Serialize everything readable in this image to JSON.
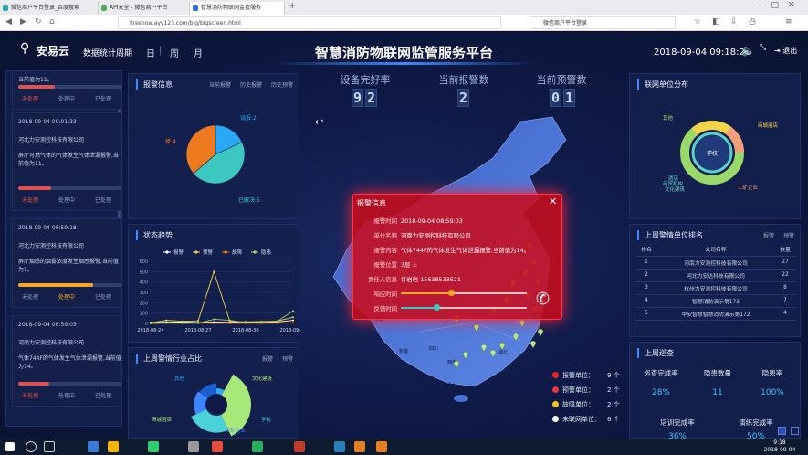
{
  "browser": {
    "tabs": [
      "微信商户平台登录_百度搜索",
      "API安全 - 微信商户平台",
      "智慧消防物联网监管服务"
    ],
    "url": "fireshow.ayy123.com/big/bigscreen.html",
    "search_value": "微信商户平台登录"
  },
  "header": {
    "logo": "安易云",
    "period_label": "数据统计周期",
    "periods": [
      "日",
      "周",
      "月"
    ],
    "title": "智慧消防物联网监管服务平台",
    "datetime": "2018-09-04 09:18:21",
    "expand_label": "缩放",
    "logout": "退出"
  },
  "kpis": [
    {
      "label": "设备完好率",
      "digits": [
        "9",
        "2"
      ]
    },
    {
      "label": "当前报警数",
      "digits": [
        "2"
      ]
    },
    {
      "label": "当前预警数",
      "digits": [
        "0",
        "1"
      ]
    }
  ],
  "feed": [
    {
      "text": "当前值为11。",
      "progress": 0.35,
      "color": "#e0524f",
      "actions": [
        "未处理",
        "处理中",
        "已处理"
      ],
      "active": 0
    },
    {
      "time": "2018-09-04 09:01:33",
      "company": "河北力安测控科技有限公司",
      "text": "屏厅可燃气体的气体发生气体泄漏报警,当前值为11。",
      "progress": 0.32,
      "color": "#e0524f",
      "actions": [
        "未处理",
        "处理中",
        "已处理"
      ],
      "active": 0
    },
    {
      "time": "2018-09-04 08:59:18",
      "company": "河北力安测控科技有限公司",
      "text": "屏厅烟感的烟雾浓度发生烟感报警,当前值为1。",
      "progress": 0.72,
      "color": "#f5a623",
      "actions": [
        "未处理",
        "处理中",
        "已处理"
      ],
      "active": 1
    },
    {
      "time": "2018-09-04 08:59:03",
      "company": "河南力安测控科技有限公司",
      "text": "气体744F的气体发生气体泄漏报警,当前值为14。",
      "progress": 0.3,
      "color": "#e0524f",
      "actions": [
        "未处理",
        "处理中",
        "已处理"
      ],
      "active": 0
    }
  ],
  "alarm_info": {
    "title": "报警信息",
    "links": [
      "当前报警",
      "历史报警",
      "历史预警"
    ],
    "pie": [
      {
        "label": "误报:2",
        "value": 2,
        "color": "#2aa7f5"
      },
      {
        "label": "已解决:5",
        "value": 5,
        "color": "#3cc8c0"
      },
      {
        "label": "已报修:4",
        "value": 4,
        "color": "#ee7a20"
      }
    ]
  },
  "trend": {
    "title": "状态趋势",
    "legend": [
      "报警",
      "预警",
      "故障",
      "隐患"
    ],
    "yticks": [
      "600",
      "500",
      "400",
      "300",
      "200",
      "100",
      "0"
    ],
    "xticks": [
      "2018-08-24",
      "2018-08-27",
      "2018-08-30",
      "2018-09-02"
    ],
    "chart_data": {
      "type": "line",
      "x": [
        "2018-08-24",
        "2018-08-25",
        "2018-08-26",
        "2018-08-27",
        "2018-08-28",
        "2018-08-29",
        "2018-08-30",
        "2018-08-31",
        "2018-09-01",
        "2018-09-02"
      ],
      "ylim": [
        0,
        600
      ],
      "series": [
        {
          "name": "报警",
          "color": "#ffffff",
          "values": [
            10,
            12,
            15,
            8,
            14,
            10,
            12,
            11,
            13,
            30
          ]
        },
        {
          "name": "预警",
          "color": "#f3d34a",
          "values": [
            5,
            30,
            20,
            25,
            500,
            20,
            15,
            18,
            22,
            60
          ]
        },
        {
          "name": "故障",
          "color": "#ee7a20",
          "values": [
            2,
            3,
            2,
            4,
            3,
            2,
            3,
            2,
            4,
            5
          ]
        },
        {
          "name": "隐患",
          "color": "#9ad86a",
          "values": [
            0,
            5,
            3,
            2,
            40,
            30,
            5,
            10,
            20,
            120
          ]
        }
      ]
    }
  },
  "industry": {
    "title": "上周警情行业占比",
    "links": [
      "报警",
      "预警"
    ],
    "labels": [
      "其他",
      "文化建筑",
      "学校",
      "工矿企业",
      "商城酒店"
    ],
    "segments": [
      {
        "label": "其他",
        "value": 8,
        "color": "#2aa7f5"
      },
      {
        "label": "文化建筑",
        "value": 35,
        "color": "#a8e87a"
      },
      {
        "label": "学校",
        "value": 25,
        "color": "#4bd1d9"
      },
      {
        "label": "工矿企业",
        "value": 17,
        "color": "#3e86ff"
      },
      {
        "label": "商城酒店",
        "value": 15,
        "color": "#1d5fd0"
      }
    ]
  },
  "alarm_popup": {
    "title": "报警信息",
    "rows": [
      {
        "k": "报警时间",
        "v": "2018-09-04 08:59:03"
      },
      {
        "k": "单位名称",
        "v": "河南力安测控科技有限公司"
      },
      {
        "k": "报警内容",
        "v": "气体744F的气体发生气体泄漏报警,当前值为14。"
      },
      {
        "k": "报警位置",
        "v": "3层"
      },
      {
        "k": "责任人信息",
        "v": "许岩岩  15638533521"
      }
    ],
    "response_label": "响应时间",
    "feedback_label": "反馈时间",
    "response_level": 0.4,
    "feedback_level": 0.28
  },
  "map_legend": [
    {
      "label": "报警单位：",
      "count": "9 个",
      "color": "#e52a2a"
    },
    {
      "label": "预警单位：",
      "count": "2 个",
      "color": "#e53a3a"
    },
    {
      "label": "故障单位：",
      "count": "2 个",
      "color": "#f2c21d"
    },
    {
      "label": "未联网单位：",
      "count": "6 个",
      "color": "#ffffff"
    }
  ],
  "map_labels": [
    "新疆",
    "西藏",
    "青海",
    "四川",
    "西南",
    "广东",
    "贵州",
    "云南",
    "湖北"
  ],
  "units_dist": {
    "title": "联网单位分布",
    "center": "学校",
    "labels": [
      "其他",
      "商城酒店",
      "酒店",
      "商贸机构",
      "文化建筑",
      "工矿企业"
    ]
  },
  "rank": {
    "title": "上周警情单位排名",
    "links": [
      "报警",
      "预警"
    ],
    "headers": [
      "排名",
      "公司名称",
      "数量"
    ],
    "rows": [
      [
        "1",
        "河南力安测控科技有限公司",
        "27"
      ],
      [
        "2",
        "河北力安达科技有限公司",
        "22"
      ],
      [
        "3",
        "杭州力安测控科技有限公司",
        "8"
      ],
      [
        "4",
        "智慧消防演示第173",
        "7"
      ],
      [
        "5",
        "中安智慧智慧消防演示第172",
        "4"
      ]
    ]
  },
  "inspection": {
    "title": "上周巡查",
    "metrics": [
      {
        "label": "巡查完成率",
        "value": "28%"
      },
      {
        "label": "隐患数量",
        "value": "11"
      },
      {
        "label": "隐患率",
        "value": "100%"
      },
      {
        "label": "培训完成率",
        "value": "36%"
      },
      {
        "label": "演练完成率",
        "value": "50%"
      }
    ]
  },
  "taskbar": {
    "time": "9:18",
    "date": "2018-09-04"
  }
}
